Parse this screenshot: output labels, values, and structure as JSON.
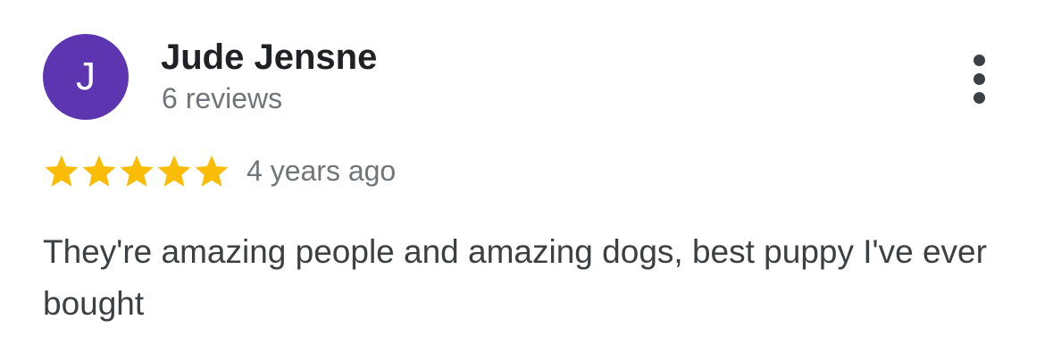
{
  "review": {
    "avatar_letter": "J",
    "reviewer_name": "Jude Jensne",
    "review_count": "6 reviews",
    "rating": 5,
    "rating_max": 5,
    "time_ago": "4 years ago",
    "text": "They're amazing people and amazing dogs, best puppy I've ever bought",
    "more_icon": "more-vert-icon"
  },
  "colors": {
    "avatar_bg": "#5e35b1",
    "star": "#fbbc04",
    "name": "#202124",
    "secondary": "#70757a",
    "body_text": "#3c4043"
  }
}
